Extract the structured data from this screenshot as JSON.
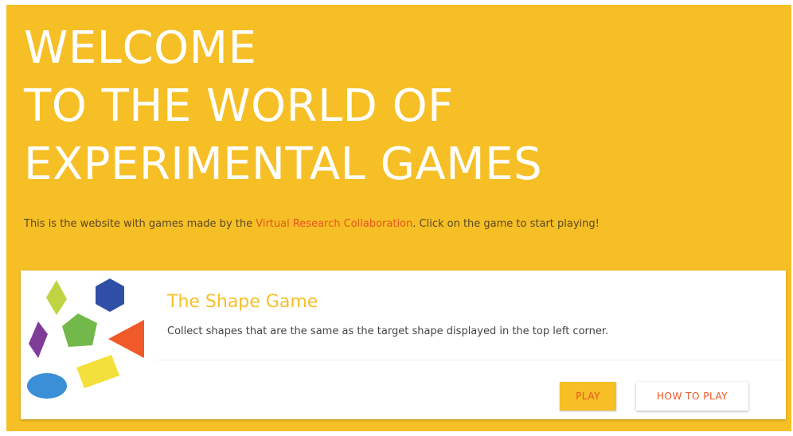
{
  "hero": {
    "title_lines": [
      "WELCOME",
      "TO THE WORLD OF",
      "EXPERIMENTAL GAMES"
    ]
  },
  "intro": {
    "before": "This is the website with games made by the ",
    "link": "Virtual Research Collaboration",
    "after": ". Click on the game to start playing!"
  },
  "game": {
    "title": "The Shape Game",
    "description": "Collect shapes that are the same as the target shape displayed in the top left corner.",
    "play_label": "PLAY",
    "how_to_label": "HOW TO PLAY"
  },
  "colors": {
    "background": "#f6bf26",
    "link": "#e8541f",
    "title_accent": "#f6bf26",
    "shape_lime": "#bfd443",
    "shape_navy": "#2f4fa6",
    "shape_purple": "#7d3c98",
    "shape_green": "#72b84a",
    "shape_orange": "#f05a28",
    "shape_blue": "#3a8fd6",
    "shape_yellow": "#f4e03a"
  }
}
